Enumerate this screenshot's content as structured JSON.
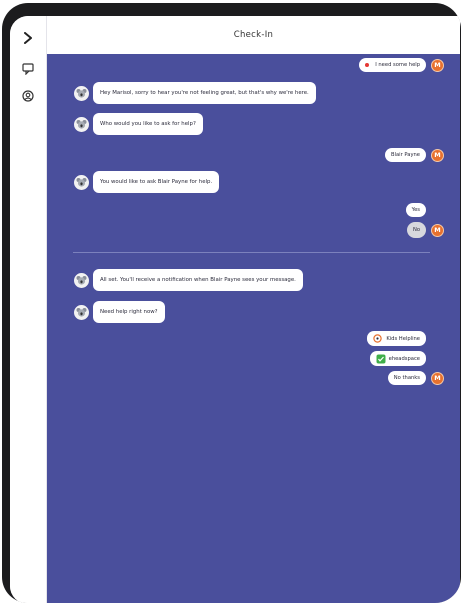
{
  "header": {
    "title": "Check-In"
  },
  "sidebar": {
    "items": [
      {
        "icon": "chevron-right-icon"
      },
      {
        "icon": "chat-icon"
      },
      {
        "icon": "profile-icon"
      }
    ]
  },
  "chat": {
    "messages": {
      "m1": {
        "text": "I need some help",
        "avatar": "M"
      },
      "m2": {
        "text": "Hey Marisol, sorry to hear you're not feeling great, but that's why we're here."
      },
      "m3": {
        "text": "Who would you like to ask for help?"
      },
      "m4": {
        "text": "Blair Payne",
        "avatar": "M"
      },
      "m5": {
        "text": "You would like to ask Blair Payne for help."
      },
      "m6": {
        "options": [
          "Yes",
          "No"
        ],
        "selected": "No",
        "avatar": "M"
      },
      "m7": {
        "text": "All set. You'll receive a notification when Blair Payne sees your message."
      },
      "m8": {
        "text": "Need help right now?"
      },
      "m9": {
        "options": [
          "Kids Helpline",
          "eheadspace",
          "No thanks"
        ],
        "avatar": "M"
      }
    }
  },
  "colors": {
    "chat_background": "#4a4f9c",
    "user_avatar": "#e8712e",
    "status_dot": "#e53935"
  }
}
